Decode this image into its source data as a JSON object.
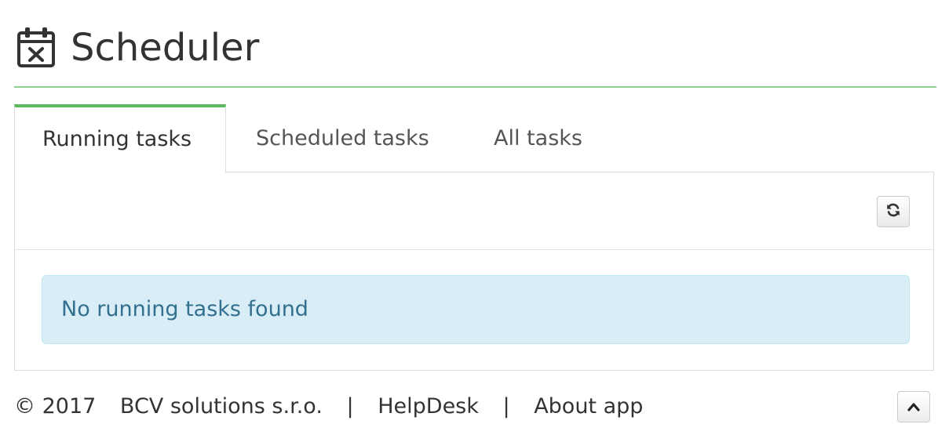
{
  "header": {
    "title": "Scheduler",
    "icon": "calendar-times-icon"
  },
  "tabs": [
    {
      "label": "Running tasks",
      "active": true
    },
    {
      "label": "Scheduled tasks",
      "active": false
    },
    {
      "label": "All tasks",
      "active": false
    }
  ],
  "toolbar": {
    "refresh_icon": "refresh-icon"
  },
  "alert": {
    "message": "No running tasks found"
  },
  "footer": {
    "copyright_symbol": "©",
    "year": "2017",
    "company": "BCV solutions s.r.o.",
    "separator": "|",
    "helpdesk": "HelpDesk",
    "about": "About app",
    "scroll_top_icon": "chevron-up-icon"
  },
  "colors": {
    "accent_green": "#5cb85c",
    "header_rule": "#8fd08f",
    "alert_bg": "#d9edf7",
    "alert_text": "#31708f"
  }
}
